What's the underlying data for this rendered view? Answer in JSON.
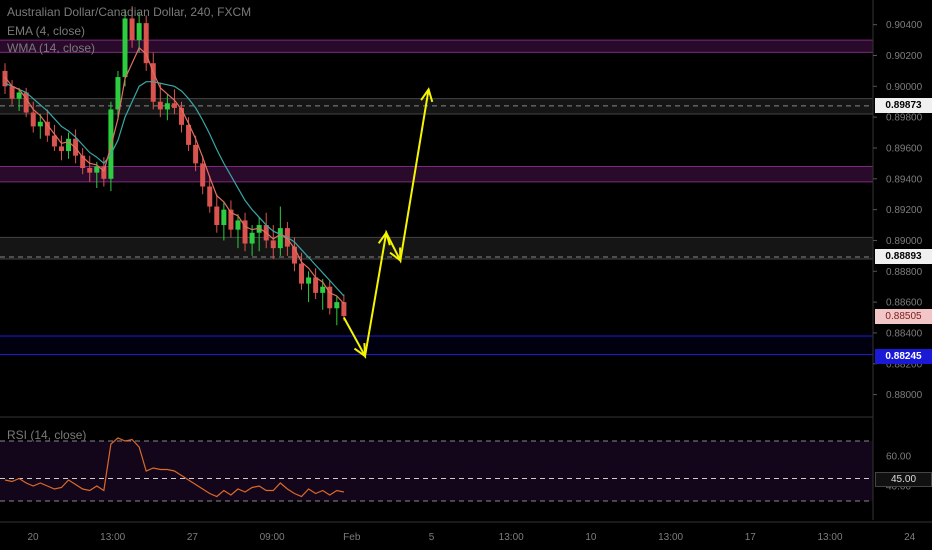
{
  "header": {
    "symbol_title": "Australian Dollar/Canadian Dollar, 240, FXCM",
    "ema_label": "EMA (4, close)",
    "wma_label": "WMA (14, close)",
    "rsi_label": "RSI (14, close)"
  },
  "price_axis": {
    "ticks": [
      "0.90400",
      "0.90200",
      "0.90000",
      "0.89800",
      "0.89600",
      "0.89400",
      "0.89200",
      "0.89000",
      "0.88800",
      "0.88600",
      "0.88400",
      "0.88200",
      "0.88000"
    ],
    "tick_values": [
      0.904,
      0.902,
      0.9,
      0.898,
      0.896,
      0.894,
      0.892,
      0.89,
      0.888,
      0.886,
      0.884,
      0.882,
      0.88
    ],
    "tags": [
      {
        "label": "0.89873",
        "value": 0.89873,
        "style": "black"
      },
      {
        "label": "0.88893",
        "value": 0.88893,
        "style": "black"
      },
      {
        "label": "0.88505",
        "value": 0.88505,
        "style": "red"
      },
      {
        "label": "0.88245",
        "value": 0.88245,
        "style": "blue"
      }
    ]
  },
  "rsi_axis": {
    "ticks": [
      "60.00",
      "40.00"
    ],
    "tick_values": [
      60,
      40
    ],
    "tag": {
      "label": "45.00",
      "value": 45
    }
  },
  "time_axis": {
    "labels": [
      "20",
      "13:00",
      "27",
      "09:00",
      "Feb",
      "5",
      "13:00",
      "10",
      "13:00",
      "17",
      "13:00",
      "24"
    ]
  },
  "colors": {
    "up_candle": "#2ecc40",
    "down_candle": "#d9534f",
    "ema": "#e07060",
    "wma": "#3aa6a6",
    "arrow": "#f5f500",
    "purple_zone": "#7b2a7b",
    "blue_zone": "#1a1ad6",
    "rsi_line": "#d96a2a"
  },
  "chart_data": {
    "type": "candlestick",
    "symbol": "AUD/CAD",
    "timeframe": "240",
    "ylim": [
      0.879,
      0.9056
    ],
    "candles": [
      [
        0.901,
        0.9015,
        0.8995,
        0.9
      ],
      [
        0.9,
        0.9004,
        0.8988,
        0.8992
      ],
      [
        0.8992,
        0.8999,
        0.8984,
        0.8996
      ],
      [
        0.8996,
        0.8999,
        0.898,
        0.8983
      ],
      [
        0.8983,
        0.899,
        0.897,
        0.8974
      ],
      [
        0.8974,
        0.8982,
        0.8966,
        0.8977
      ],
      [
        0.8977,
        0.8985,
        0.8964,
        0.8968
      ],
      [
        0.8968,
        0.8975,
        0.8958,
        0.8961
      ],
      [
        0.8961,
        0.8968,
        0.8952,
        0.8958
      ],
      [
        0.8958,
        0.897,
        0.8953,
        0.8966
      ],
      [
        0.8966,
        0.8972,
        0.895,
        0.8955
      ],
      [
        0.8955,
        0.896,
        0.8943,
        0.8947
      ],
      [
        0.8947,
        0.8955,
        0.8938,
        0.8944
      ],
      [
        0.8944,
        0.8951,
        0.8934,
        0.8948
      ],
      [
        0.8948,
        0.8954,
        0.8935,
        0.894
      ],
      [
        0.894,
        0.899,
        0.8932,
        0.8985
      ],
      [
        0.8985,
        0.901,
        0.8978,
        0.9006
      ],
      [
        0.9006,
        0.905,
        0.9,
        0.9044
      ],
      [
        0.9044,
        0.9052,
        0.9025,
        0.903
      ],
      [
        0.903,
        0.9048,
        0.9022,
        0.9041
      ],
      [
        0.9041,
        0.9046,
        0.901,
        0.9015
      ],
      [
        0.9015,
        0.9022,
        0.8985,
        0.899
      ],
      [
        0.899,
        0.9002,
        0.898,
        0.8985
      ],
      [
        0.8985,
        0.8995,
        0.8978,
        0.8989
      ],
      [
        0.8989,
        0.8998,
        0.8982,
        0.8986
      ],
      [
        0.8986,
        0.899,
        0.897,
        0.8975
      ],
      [
        0.8975,
        0.898,
        0.8958,
        0.8962
      ],
      [
        0.8962,
        0.8968,
        0.8945,
        0.895
      ],
      [
        0.895,
        0.8955,
        0.893,
        0.8935
      ],
      [
        0.8935,
        0.8942,
        0.8918,
        0.8922
      ],
      [
        0.8922,
        0.893,
        0.8905,
        0.891
      ],
      [
        0.891,
        0.8925,
        0.89,
        0.892
      ],
      [
        0.892,
        0.8926,
        0.8902,
        0.8907
      ],
      [
        0.8907,
        0.8917,
        0.8895,
        0.8913
      ],
      [
        0.8913,
        0.8918,
        0.8893,
        0.8898
      ],
      [
        0.8898,
        0.891,
        0.889,
        0.8905
      ],
      [
        0.8905,
        0.8915,
        0.8893,
        0.891
      ],
      [
        0.891,
        0.8918,
        0.8895,
        0.89
      ],
      [
        0.89,
        0.891,
        0.8888,
        0.8895
      ],
      [
        0.8895,
        0.8922,
        0.889,
        0.8908
      ],
      [
        0.8908,
        0.8912,
        0.889,
        0.8896
      ],
      [
        0.8896,
        0.8902,
        0.888,
        0.8885
      ],
      [
        0.8885,
        0.8892,
        0.8868,
        0.8872
      ],
      [
        0.8872,
        0.888,
        0.886,
        0.8876
      ],
      [
        0.8876,
        0.8882,
        0.8862,
        0.8866
      ],
      [
        0.8866,
        0.8875,
        0.8855,
        0.887
      ],
      [
        0.887,
        0.8874,
        0.8852,
        0.8856
      ],
      [
        0.8856,
        0.8864,
        0.8845,
        0.886
      ],
      [
        0.886,
        0.8865,
        0.8848,
        0.8851
      ]
    ],
    "ema": [
      0.9006,
      0.9,
      0.8998,
      0.8992,
      0.8985,
      0.8981,
      0.8975,
      0.8969,
      0.8963,
      0.8964,
      0.896,
      0.8954,
      0.895,
      0.8949,
      0.8945,
      0.8961,
      0.8979,
      0.9005,
      0.9015,
      0.9025,
      0.9021,
      0.9009,
      0.8999,
      0.8995,
      0.8991,
      0.8985,
      0.8976,
      0.8966,
      0.8954,
      0.8941,
      0.8929,
      0.8925,
      0.8918,
      0.8916,
      0.8909,
      0.8907,
      0.8908,
      0.8905,
      0.8901,
      0.8904,
      0.8901,
      0.8895,
      0.8886,
      0.8882,
      0.8876,
      0.8873,
      0.8866,
      0.8864,
      0.8859
    ],
    "wma": [
      0.9002,
      0.9,
      0.8998,
      0.8996,
      0.8992,
      0.8988,
      0.8984,
      0.8979,
      0.8974,
      0.8971,
      0.8967,
      0.8962,
      0.8957,
      0.8954,
      0.895,
      0.8956,
      0.8965,
      0.898,
      0.899,
      0.9,
      0.9003,
      0.9003,
      0.9002,
      0.9001,
      0.9,
      0.8997,
      0.8992,
      0.8986,
      0.8978,
      0.8969,
      0.8959,
      0.895,
      0.8942,
      0.8934,
      0.8926,
      0.892,
      0.8915,
      0.891,
      0.8906,
      0.8904,
      0.8902,
      0.8899,
      0.8894,
      0.8889,
      0.8884,
      0.8879,
      0.8874,
      0.8869,
      0.8864
    ],
    "rsi": [
      44,
      43,
      45,
      42,
      40,
      42,
      40,
      38,
      39,
      44,
      41,
      38,
      37,
      40,
      37,
      68,
      72,
      70,
      71,
      66,
      50,
      52,
      51,
      51,
      50,
      47,
      44,
      41,
      38,
      35,
      33,
      37,
      34,
      38,
      36,
      39,
      40,
      37,
      37,
      42,
      38,
      35,
      33,
      38,
      35,
      37,
      34,
      37,
      36
    ],
    "arrow_path": [
      [
        48,
        0.885
      ],
      [
        51,
        0.8825
      ],
      [
        54,
        0.8905
      ],
      [
        56,
        0.8887
      ],
      [
        60,
        0.8998
      ]
    ],
    "horizontal_lines": [
      {
        "kind": "zone",
        "from": 0.9022,
        "to": 0.903,
        "color": "purple"
      },
      {
        "kind": "zone",
        "from": 0.8982,
        "to": 0.8992,
        "color": "gray",
        "level": 0.89873
      },
      {
        "kind": "zone",
        "from": 0.8938,
        "to": 0.8948,
        "color": "purple"
      },
      {
        "kind": "zone",
        "from": 0.8888,
        "to": 0.8902,
        "color": "gray",
        "level": 0.88893
      },
      {
        "kind": "zone",
        "from": 0.8826,
        "to": 0.8838,
        "color": "blue",
        "level": 0.88245
      }
    ],
    "rsi_levels": [
      70,
      45,
      30
    ]
  }
}
